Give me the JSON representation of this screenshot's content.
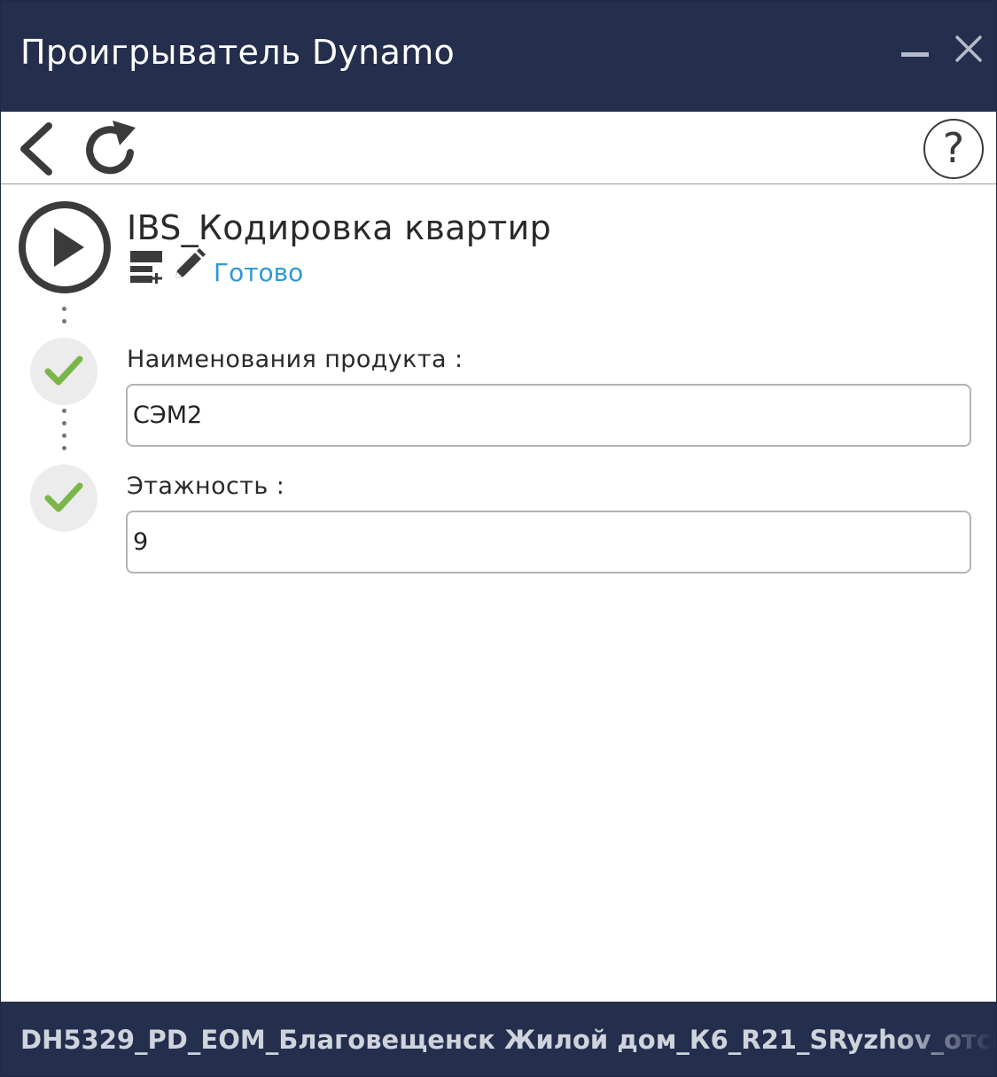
{
  "window": {
    "title": "Проигрыватель Dynamo"
  },
  "toolbar": {
    "help_label": "?"
  },
  "script": {
    "name": "IBS_Кодировка квартир",
    "status": "Готово"
  },
  "inputs": [
    {
      "label": "Наименования продукта :",
      "value": "СЭМ2"
    },
    {
      "label": "Этажность :",
      "value": "9"
    }
  ],
  "footer": {
    "document_name": "DH5329_PD_EOM_Благовещенск Жилой дом_К6_R21_SRyzhov_отсо"
  },
  "icons": {
    "minimize": "minimize-icon",
    "close": "close-icon",
    "back": "chevron-left-icon",
    "refresh": "refresh-icon",
    "help": "help-icon",
    "play": "play-icon",
    "graph": "graph-view-icon",
    "edit": "pencil-icon",
    "check": "checkmark-icon"
  },
  "colors": {
    "titlebar_bg": "#242e4d",
    "status_text": "#2d9ad2",
    "check_green": "#7ab648",
    "check_circle_bg": "#ececec"
  }
}
